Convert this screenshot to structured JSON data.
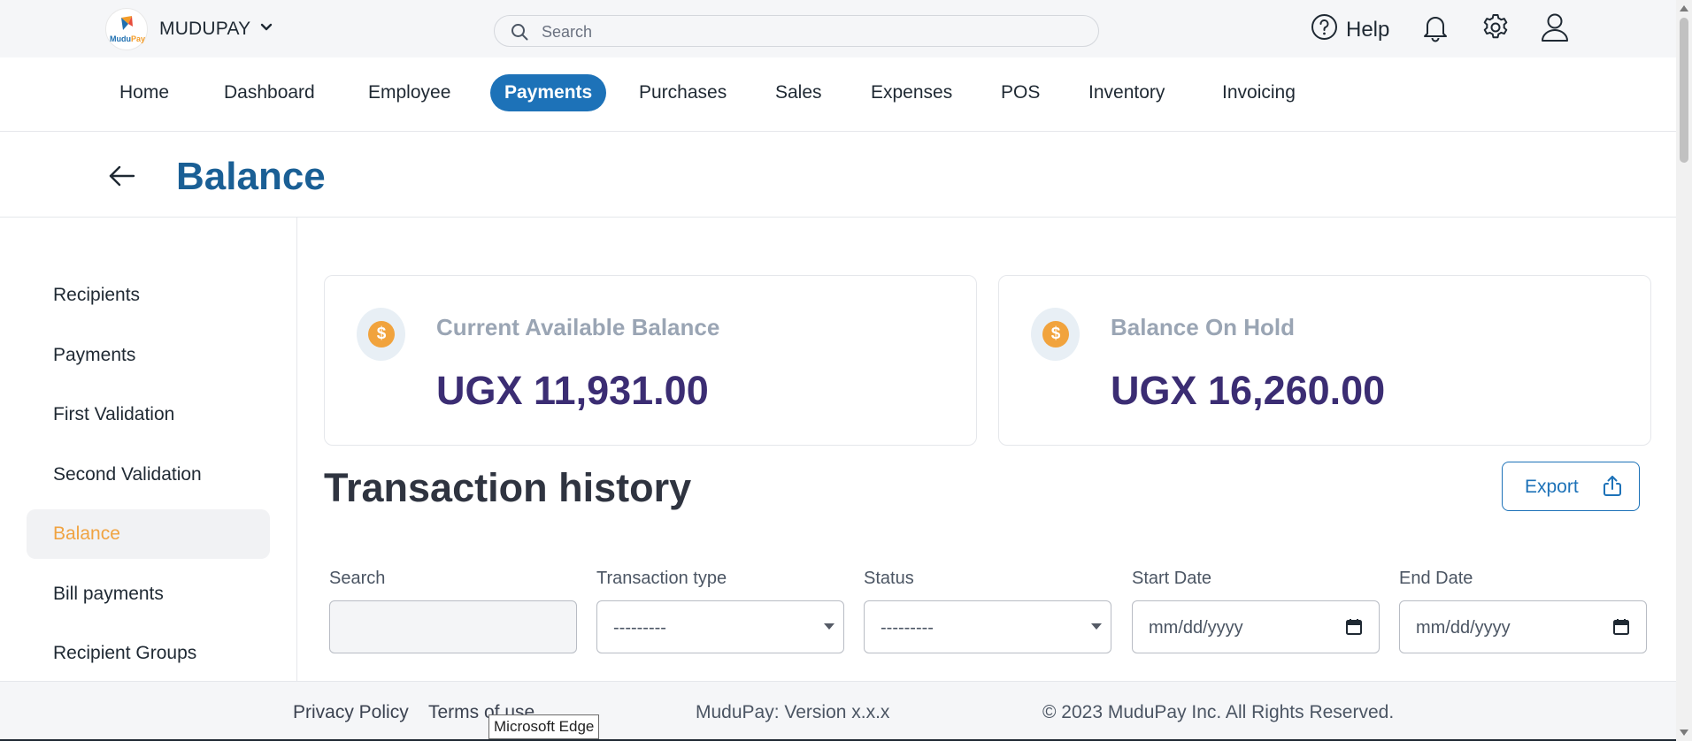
{
  "header": {
    "logo_text_a": "Mudu",
    "logo_text_b": "Pay",
    "brand": "MUDUPAY",
    "search_placeholder": "Search",
    "help_label": "Help"
  },
  "nav": {
    "items": [
      "Home",
      "Dashboard",
      "Employee",
      "Payments",
      "Purchases",
      "Sales",
      "Expenses",
      "POS",
      "Inventory",
      "Invoicing"
    ],
    "active": "Payments"
  },
  "page": {
    "title": "Balance"
  },
  "sidebar": {
    "items": [
      "Recipients",
      "Payments",
      "First Validation",
      "Second Validation",
      "Balance",
      "Bill payments",
      "Recipient Groups"
    ],
    "active": "Balance"
  },
  "cards": [
    {
      "label": "Current Available Balance",
      "amount": "UGX 11,931.00",
      "icon": "dollar-coin-icon"
    },
    {
      "label": "Balance On Hold",
      "amount": "UGX 16,260.00",
      "icon": "dollar-coin-icon"
    }
  ],
  "transactions": {
    "title": "Transaction history",
    "export_label": "Export",
    "filters": {
      "search_label": "Search",
      "search_value": "",
      "type_label": "Transaction type",
      "type_value": "---------",
      "status_label": "Status",
      "status_value": "---------",
      "start_label": "Start Date",
      "start_value": "mm/dd/yyyy",
      "end_label": "End Date",
      "end_value": "mm/dd/yyyy"
    }
  },
  "footer": {
    "privacy": "Privacy Policy",
    "terms": "Terms of use",
    "version": "MuduPay: Version x.x.x",
    "copyright": "© 2023 MuduPay Inc. All Rights Reserved.",
    "tooltip": "Microsoft Edge"
  },
  "colors": {
    "accent": "#1d72b8",
    "title": "#1a5f95",
    "amount": "#3b2d73",
    "active_sidebar": "#f0a341",
    "coin": "#f1a33d"
  }
}
